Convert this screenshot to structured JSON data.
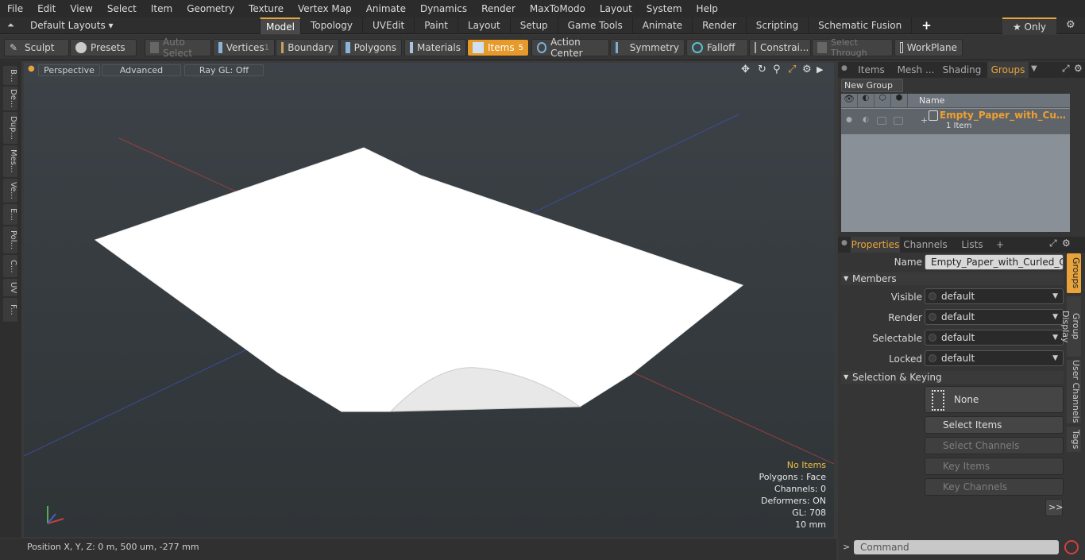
{
  "menu": [
    "File",
    "Edit",
    "View",
    "Select",
    "Item",
    "Geometry",
    "Texture",
    "Vertex Map",
    "Animate",
    "Dynamics",
    "Render",
    "MaxToModo",
    "Layout",
    "System",
    "Help"
  ],
  "layouts_label": "Default Layouts ▾",
  "tabs": [
    "Model",
    "Topology",
    "UVEdit",
    "Paint",
    "Layout",
    "Setup",
    "Game Tools",
    "Animate",
    "Render",
    "Scripting",
    "Schematic Fusion",
    "+"
  ],
  "only_label": "★ Only",
  "toolbar": {
    "sculpt": "Sculpt",
    "presets": "Presets",
    "auto_select": "Auto Select",
    "vertices": "Vertices",
    "vertices_count": "1",
    "boundary": "Boundary",
    "polygons": "Polygons",
    "materials": "Materials",
    "items": "Items",
    "items_count": "5",
    "action_center": "Action Center",
    "symmetry": "Symmetry",
    "falloff": "Falloff",
    "constraints": "Constrai...",
    "select_through": "Select Through",
    "workplane": "WorkPlane"
  },
  "left_tabs": [
    "B...",
    "De...",
    "Dup...",
    "Mes...",
    "Ve...",
    "E...",
    "Pol...",
    "C...",
    "UV",
    "F..."
  ],
  "viewport": {
    "perspective": "Perspective",
    "advanced": "Advanced",
    "raygl": "Ray GL: Off"
  },
  "stats": {
    "items": "No Items",
    "polygons": "Polygons : Face",
    "channels": "Channels: 0",
    "deformers": "Deformers: ON",
    "gl": "GL: 708",
    "scale": "10 mm"
  },
  "status": "Position X, Y, Z:   0 m, 500 um, -277 mm",
  "panel_tabs": [
    "Items",
    "Mesh ...",
    "Shading",
    "Groups"
  ],
  "new_group": "New Group",
  "group_header": "Name",
  "group_name": "Empty_Paper_with_Curled_Corner",
  "group_sub": "1 Item",
  "prop_tabs": [
    "Properties",
    "Channels",
    "Lists",
    "+"
  ],
  "props": {
    "name_label": "Name",
    "name_value": "Empty_Paper_with_Curled_Corne",
    "members": "Members",
    "visible": "Visible",
    "render": "Render",
    "selectable": "Selectable",
    "locked": "Locked",
    "default": "default",
    "sel_key": "Selection & Keying",
    "none": "None",
    "select_items": "Select Items",
    "select_channels": "Select Channels",
    "key_items": "Key Items",
    "key_channels": "Key Channels",
    "more": ">>"
  },
  "vtabs": [
    "Groups",
    "Group Display",
    "User Channels",
    "Tags"
  ],
  "command_placeholder": "Command",
  "colors": {
    "accent": "#e8a43b",
    "items_button": "#e59a2b"
  }
}
